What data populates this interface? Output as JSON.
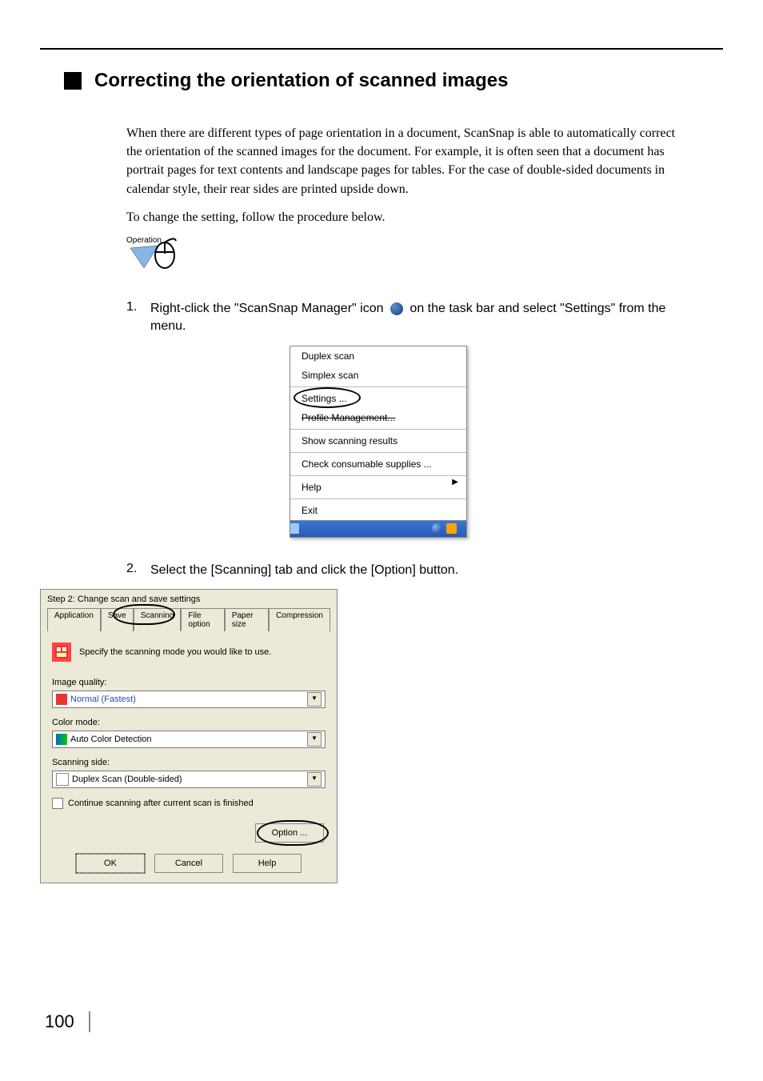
{
  "heading": "Correcting the orientation of scanned images",
  "paragraph": "When there are different types of page orientation in a document, ScanSnap is able to automatically correct the orientation of the scanned images for the document. For example, it is often seen that a document has portrait pages for text contents and landscape pages for tables. For the case of double-sided documents in calendar style, their rear sides are printed upside down.",
  "paragraph2": "To change the setting, follow the procedure below.",
  "operation_label": "Operation",
  "steps": {
    "s1_num": "1.",
    "s1_a": "Right-click the \"ScanSnap Manager\" icon",
    "s1_b": "on the task bar and select \"Settings\" from the menu.",
    "s2_num": "2.",
    "s2": "Select the [Scanning] tab and click the [Option] button."
  },
  "ctx": {
    "duplex": "Duplex scan",
    "simplex": "Simplex scan",
    "settings": "Settings ...",
    "profile": "Profile Management...",
    "show": "Show scanning results",
    "check": "Check consumable supplies ...",
    "help": "Help",
    "exit": "Exit"
  },
  "dlg": {
    "step_text": "Step 2: Change scan and save settings",
    "tabs": {
      "application": "Application",
      "save": "Save",
      "scanning": "Scanning",
      "file": "File option",
      "paper": "Paper size",
      "compression": "Compression"
    },
    "note": "Specify the scanning mode you would like to use.",
    "image_quality_label": "Image quality:",
    "image_quality_value": "Normal (Fastest)",
    "color_mode_label": "Color mode:",
    "color_mode_value": "Auto Color Detection",
    "scanning_side_label": "Scanning side:",
    "scanning_side_value": "Duplex Scan (Double-sided)",
    "continue": "Continue scanning after current scan is finished",
    "option": "Option ...",
    "ok": "OK",
    "cancel": "Cancel",
    "help": "Help"
  },
  "page_number": "100"
}
